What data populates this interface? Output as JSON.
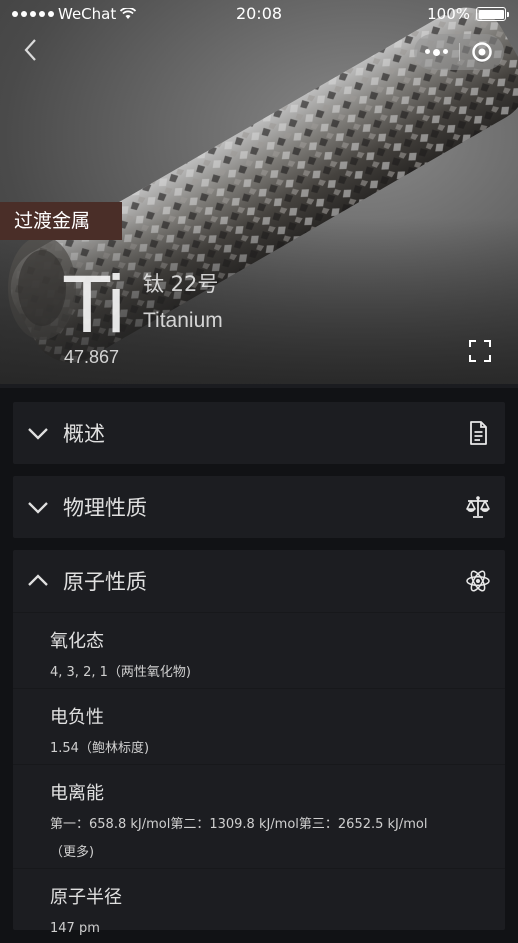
{
  "status_bar": {
    "carrier": "WeChat",
    "time": "20:08",
    "battery": "100%"
  },
  "element": {
    "category": "过渡金属",
    "symbol": "Ti",
    "name_number": "钛 22号",
    "english_name": "Titanium",
    "atomic_mass": "47.867"
  },
  "sections": [
    {
      "title": "概述",
      "expanded": false,
      "icon": "document-icon"
    },
    {
      "title": "物理性质",
      "expanded": false,
      "icon": "scale-icon"
    },
    {
      "title": "原子性质",
      "expanded": true,
      "icon": "atom-icon",
      "items": [
        {
          "label": "氧化态",
          "value": "4, 3, 2, 1（两性氧化物)"
        },
        {
          "label": "电负性",
          "value": "1.54（鲍林标度)"
        },
        {
          "label": "电离能",
          "value": "第一：658.8 kJ/mol第二：1309.8 kJ/mol第三：2652.5 kJ/mol（更多)"
        },
        {
          "label": "原子半径",
          "value": "147 pm"
        }
      ]
    }
  ],
  "colors": {
    "category_bg": "#4a2e28",
    "card_bg": "#1c1d21",
    "page_bg": "#111215"
  }
}
